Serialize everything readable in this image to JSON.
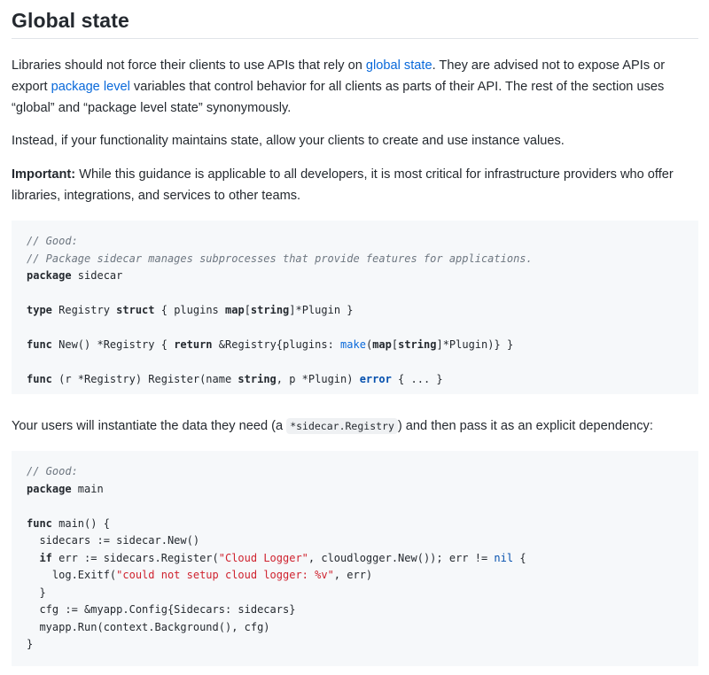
{
  "section": {
    "title": "Global state"
  },
  "p1": {
    "t1": "Libraries should not force their clients to use APIs that rely on ",
    "link1": "global state",
    "t2": ". They are advised not to expose APIs or export ",
    "link2": "package level",
    "t3": " variables that control behavior for all clients as parts of their API. The rest of the section uses “global” and “package level state” synonymously."
  },
  "p2": {
    "text": "Instead, if your functionality maintains state, allow your clients to create and use instance values."
  },
  "p3": {
    "bold": "Important:",
    "text": " While this guidance is applicable to all developers, it is most critical for infrastructure providers who offer libraries, integrations, and services to other teams."
  },
  "code1": {
    "l1": "// Good:",
    "l2": "// Package sidecar manages subprocesses that provide features for applications.",
    "l3_kw": "package",
    "l3_rest": " sidecar",
    "l5_kw": "type",
    "l5_a": " Registry ",
    "l5_kw2": "struct",
    "l5_b": " { plugins ",
    "l5_map": "map",
    "l5_c": "[",
    "l5_str": "string",
    "l5_d": "]*Plugin }",
    "l7_kw": "func",
    "l7_a": " New() *Registry { ",
    "l7_ret": "return",
    "l7_b": " &Registry{plugins: ",
    "l7_make": "make",
    "l7_c": "(",
    "l7_map": "map",
    "l7_d": "[",
    "l7_str": "string",
    "l7_e": "]*Plugin)} }",
    "l9_kw": "func",
    "l9_a": " (r *Registry) Register(name ",
    "l9_str": "string",
    "l9_b": ", p *Plugin) ",
    "l9_err": "error",
    "l9_c": " { ... }"
  },
  "p4": {
    "t1": "Your users will instantiate the data they need (a ",
    "code": "*sidecar.Registry",
    "t2": ") and then pass it as an explicit dependency:"
  },
  "code2": {
    "l1": "// Good:",
    "l2_kw": "package",
    "l2_rest": " main",
    "l4_kw": "func",
    "l4_rest": " main() {",
    "l5": "  sidecars := sidecar.New()",
    "l6_ind": "  ",
    "l6_if": "if",
    "l6_a": " err := sidecars.Register(",
    "l6_str": "\"Cloud Logger\"",
    "l6_b": ", cloudlogger.New()); err != ",
    "l6_nil": "nil",
    "l6_c": " {",
    "l7_a": "    log.Exitf(",
    "l7_str": "\"could not setup cloud logger: %v\"",
    "l7_b": ", err)",
    "l8": "  }",
    "l9": "  cfg := &myapp.Config{Sidecars: sidecars}",
    "l10": "  myapp.Run(context.Background(), cfg)",
    "l11": "}"
  }
}
